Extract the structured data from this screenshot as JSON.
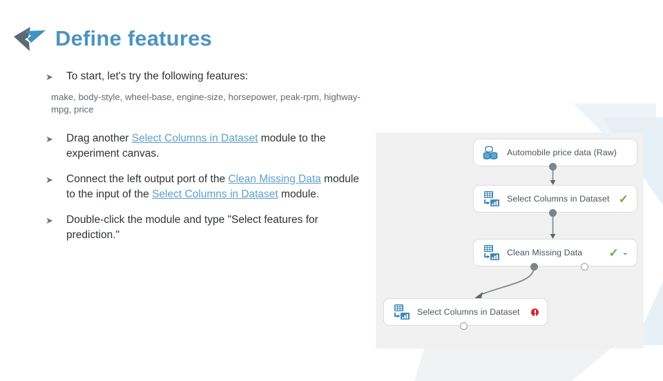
{
  "header": {
    "title": "Define features",
    "logo_icon": "chevron-logo-icon",
    "title_color": "#4d94bf"
  },
  "content": {
    "bullet_marker_icon": "arrow-bullet-icon",
    "bullets": [
      {
        "id": "b1",
        "text": "To start, let's try the following features:"
      },
      {
        "id": "b3",
        "text_parts": [
          {
            "t": "Drag another ",
            "link": false
          },
          {
            "t": "Select Columns in Dataset",
            "link": true
          },
          {
            "t": " module to the experiment canvas.",
            "link": false
          }
        ]
      },
      {
        "id": "b4",
        "text_parts": [
          {
            "t": "Connect the left output port of the ",
            "link": false
          },
          {
            "t": "Clean Missing Data",
            "link": true
          },
          {
            "t": " module to the input of the ",
            "link": false
          },
          {
            "t": "Select Columns in Dataset",
            "link": true
          },
          {
            "t": " module.",
            "link": false
          }
        ]
      },
      {
        "id": "b5",
        "text": "Double-click the module and type \"Select features for prediction.\""
      }
    ],
    "bullet_1_text": "To start, let's try the following features:",
    "feature_list": "make, body-style, wheel-base, engine-size, horsepower, peak-rpm, highway-mpg, price",
    "bullet_3_pre": "Drag another ",
    "bullet_3_link": "Select Columns in Dataset",
    "bullet_3_post": " module to the experiment canvas.",
    "bullet_4_pre": "Connect the left output port of the ",
    "bullet_4_link_1": "Clean Missing Data",
    "bullet_4_mid": " module to the input of the ",
    "bullet_4_link_2": "Select Columns in Dataset",
    "bullet_4_post": " module.",
    "bullet_5_text": "Double-click the module and type \"Select features for prediction.\"",
    "link_color": "#5c9fcb"
  },
  "canvas": {
    "background": "#f1f1f1",
    "modules": [
      {
        "id": "dataset",
        "label": "Automobile price data (Raw)",
        "icon": "database-icon",
        "status": "none"
      },
      {
        "id": "select_1",
        "label": "Select Columns in Dataset",
        "icon": "select-columns-icon",
        "status": "ok",
        "status_glyph": "✓"
      },
      {
        "id": "clean",
        "label": "Clean Missing Data",
        "icon": "select-columns-icon",
        "status": "ok",
        "status_glyph": "✓",
        "chevron_glyph": "⌄"
      },
      {
        "id": "select_2",
        "label": "Select Columns in Dataset",
        "icon": "select-columns-icon",
        "status": "error"
      }
    ],
    "status_colors": {
      "ok": "#6aab3c",
      "error": "#d7222b"
    },
    "connector_color": "#7e8589"
  }
}
